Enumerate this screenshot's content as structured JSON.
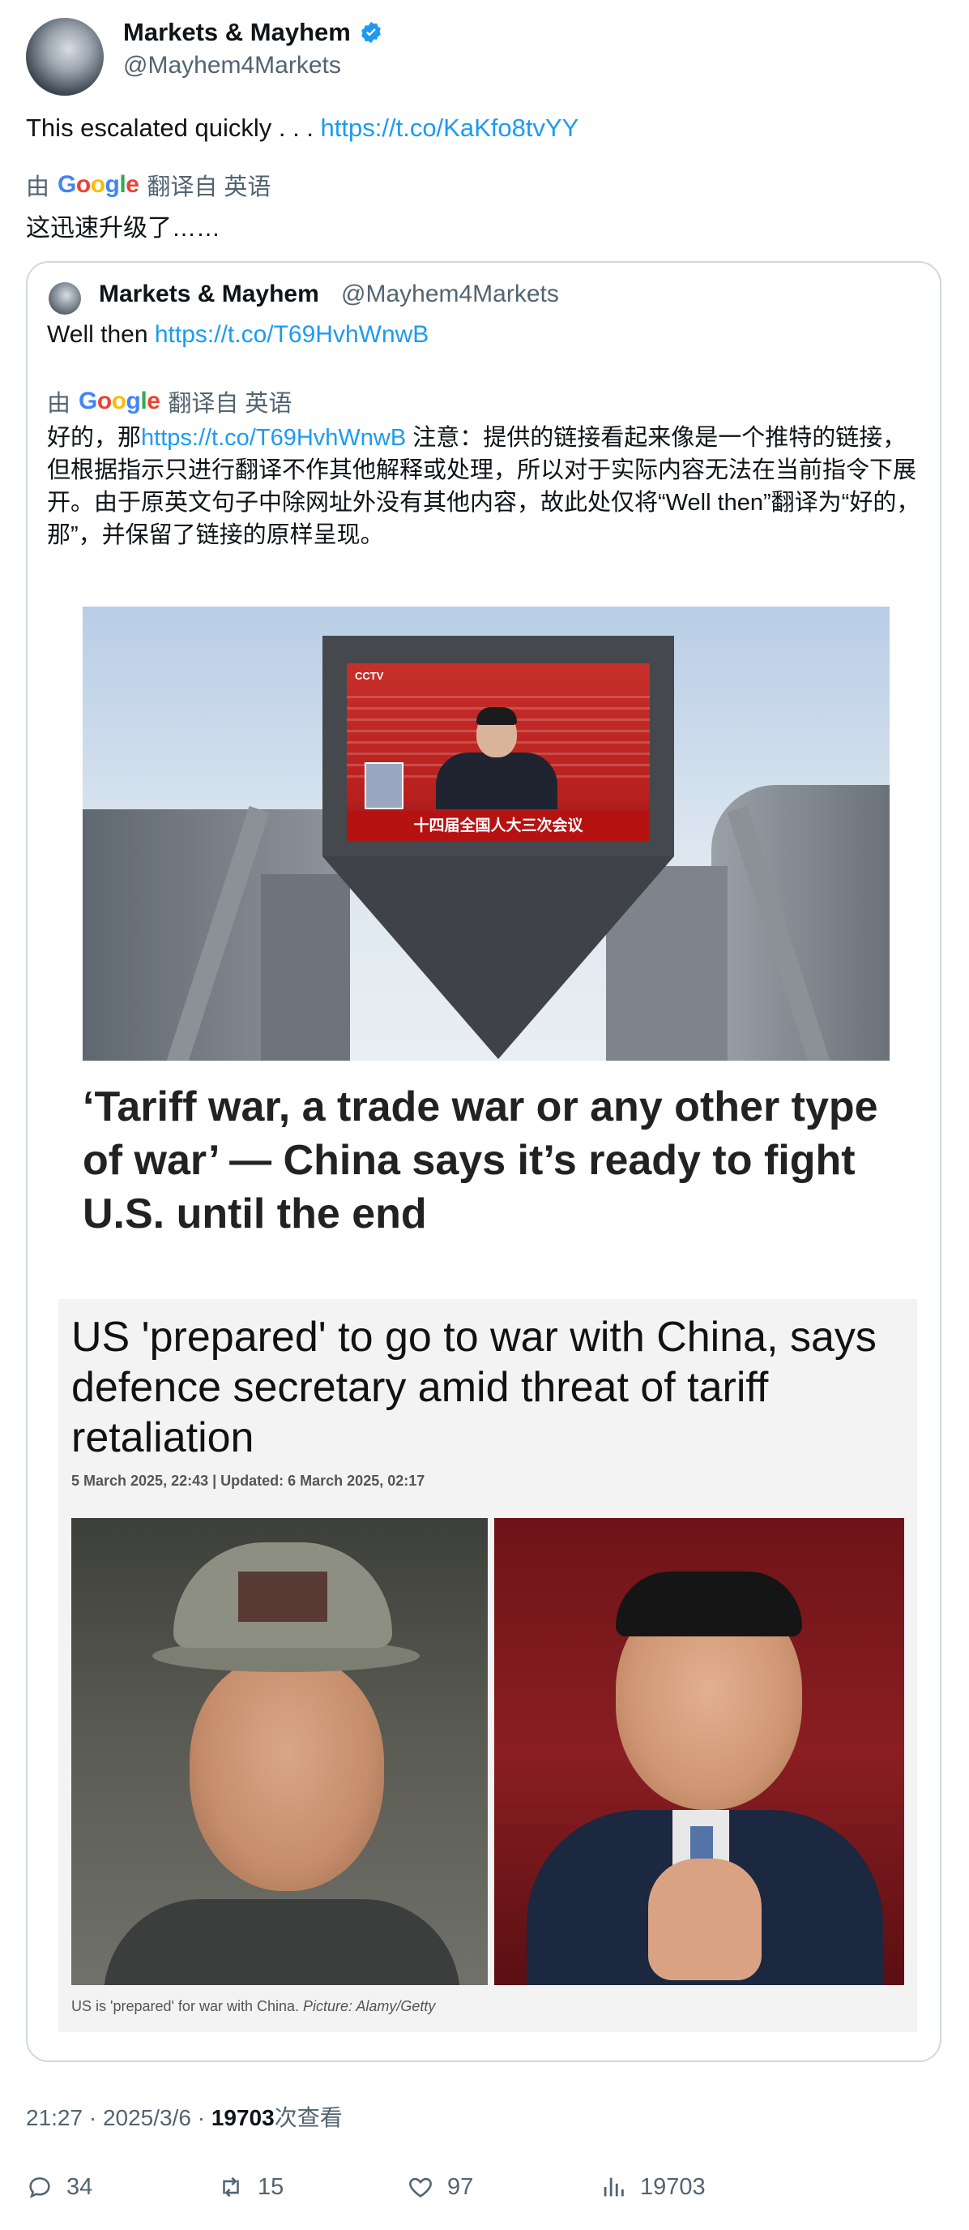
{
  "author": {
    "name": "Markets & Mayhem",
    "handle": "@Mayhem4Markets",
    "verified": true
  },
  "tweet": {
    "text": "This escalated quickly . . . ",
    "link": "https://t.co/KaKfo8tvYY",
    "translation": {
      "by": "由",
      "brand": "Google",
      "label": "翻译自 英语",
      "text": "这迅速升级了……"
    }
  },
  "quoted": {
    "name": "Markets & Mayhem",
    "handle": "@Mayhem4Markets",
    "text": "Well then ",
    "link": "https://t.co/T69HvhWnwB",
    "translation": {
      "by": "由",
      "brand": "Google",
      "label": "翻译自 英语",
      "prefix": "好的，那",
      "link": "https://t.co/T69HvhWnwB",
      "suffix": " 注意：提供的链接看起来像是一个推特的链接，但根据指示只进行翻译不作其他解释或处理，所以对于实际内容无法在当前指令下展开。由于原英文句子中除网址外没有其他内容，故此处仅将“Well then”翻译为“好的，那”，并保留了链接的原样呈现。"
    },
    "image1": {
      "screen_banner": "十四届全国人大三次会议",
      "screen_logo": "CCTV"
    },
    "headline": "‘Tariff war, a trade war or any other type of war’ — China says it’s ready to fight U.S. until the end",
    "article": {
      "title": "US 'prepared' to go to war with China, says defence secretary amid threat of tariff retaliation",
      "date": "5 March 2025, 22:43 | Updated: 6 March 2025, 02:17",
      "caption": "US is 'prepared' for war with China. ",
      "credit": "Picture: Alamy/Getty"
    }
  },
  "footer": {
    "time": "21:27 · 2025/3/6 · ",
    "views": "19703",
    "views_label": "次查看"
  },
  "stats": {
    "replies": "34",
    "retweets": "15",
    "likes": "97",
    "views": "19703"
  },
  "colors": {
    "link": "#1d9bf0",
    "secondary": "#536471",
    "verified": "#1d9bf0"
  }
}
